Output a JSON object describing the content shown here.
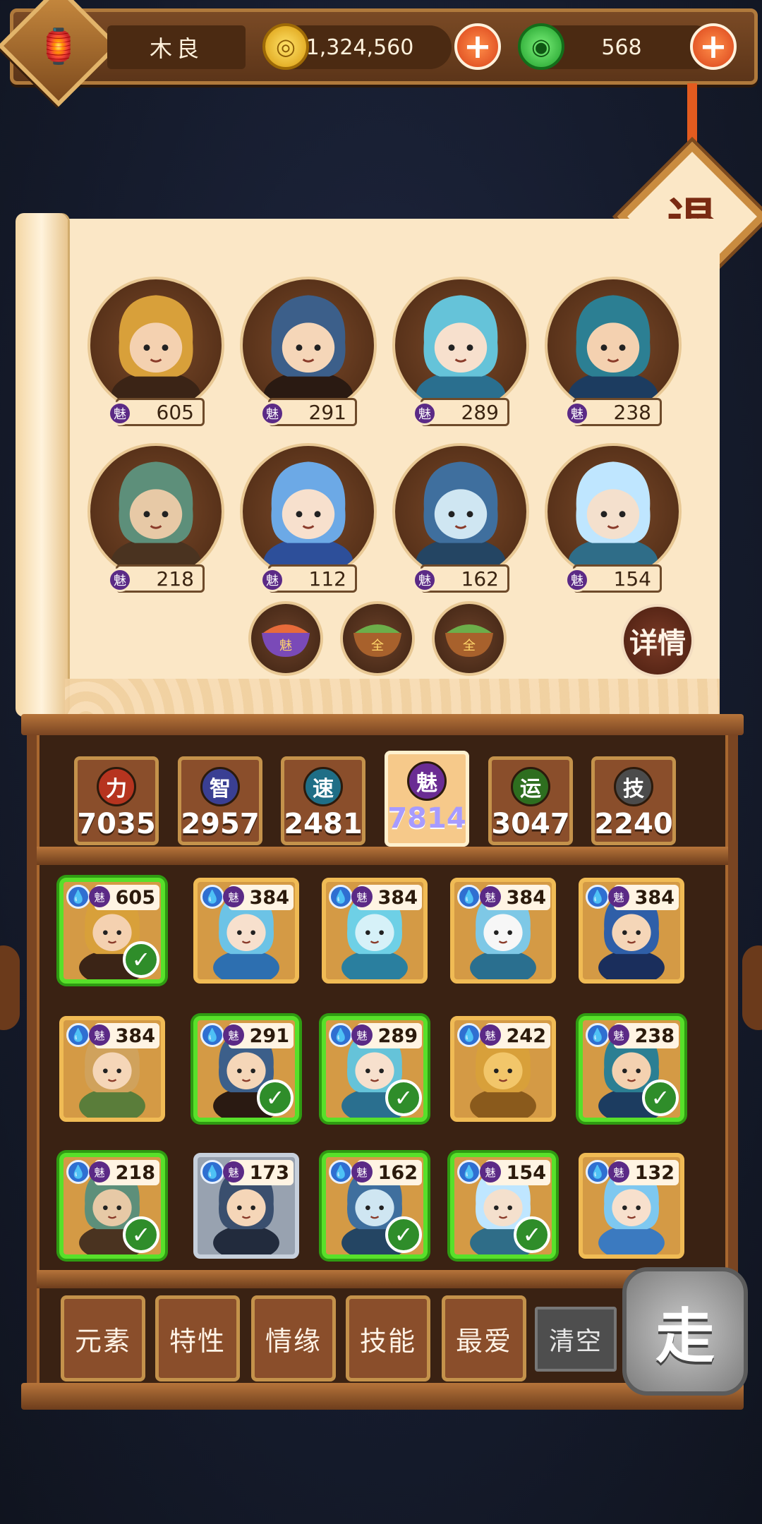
{
  "header": {
    "player_name": "木良",
    "coins": "1,324,560",
    "gems": "568",
    "plus": "+"
  },
  "exit_label": "退",
  "featured_heroes": [
    {
      "charm": "605"
    },
    {
      "charm": "291"
    },
    {
      "charm": "289"
    },
    {
      "charm": "238"
    },
    {
      "charm": "218"
    },
    {
      "charm": "112"
    },
    {
      "charm": "162"
    },
    {
      "charm": "154"
    }
  ],
  "charm_glyph": "魅",
  "food_items": [
    {
      "label": "魅"
    },
    {
      "label": "全"
    },
    {
      "label": "全"
    }
  ],
  "detail_label": "详情",
  "stat_tabs": [
    {
      "label": "力",
      "value": "7035",
      "color": "#b6341f"
    },
    {
      "label": "智",
      "value": "2957",
      "color": "#3a3f93"
    },
    {
      "label": "速",
      "value": "2481",
      "color": "#1f6e86"
    },
    {
      "label": "魅",
      "value": "7814",
      "color": "#6a2c93"
    },
    {
      "label": "运",
      "value": "3047",
      "color": "#2e6e1f"
    },
    {
      "label": "技",
      "value": "2240",
      "color": "#4b4b4b"
    }
  ],
  "hero_cards": [
    {
      "charm": "605",
      "selected": true
    },
    {
      "charm": "384",
      "selected": false
    },
    {
      "charm": "384",
      "selected": false
    },
    {
      "charm": "384",
      "selected": false
    },
    {
      "charm": "384",
      "selected": false
    },
    {
      "charm": "384",
      "selected": false
    },
    {
      "charm": "291",
      "selected": true
    },
    {
      "charm": "289",
      "selected": true
    },
    {
      "charm": "242",
      "selected": false
    },
    {
      "charm": "238",
      "selected": true
    },
    {
      "charm": "218",
      "selected": true
    },
    {
      "charm": "173",
      "selected": false
    },
    {
      "charm": "162",
      "selected": true
    },
    {
      "charm": "154",
      "selected": true
    },
    {
      "charm": "132",
      "selected": false
    }
  ],
  "element_icon": "water-drop-icon",
  "filter_buttons": [
    {
      "label": "元素"
    },
    {
      "label": "特性"
    },
    {
      "label": "情缘"
    },
    {
      "label": "技能"
    },
    {
      "label": "最爱"
    }
  ],
  "clear_label": "清空",
  "go_label": "走",
  "colors": {
    "selected_border": "#58e02a",
    "charm_dot": "#5b2a86",
    "water": "#2f6fd1"
  }
}
